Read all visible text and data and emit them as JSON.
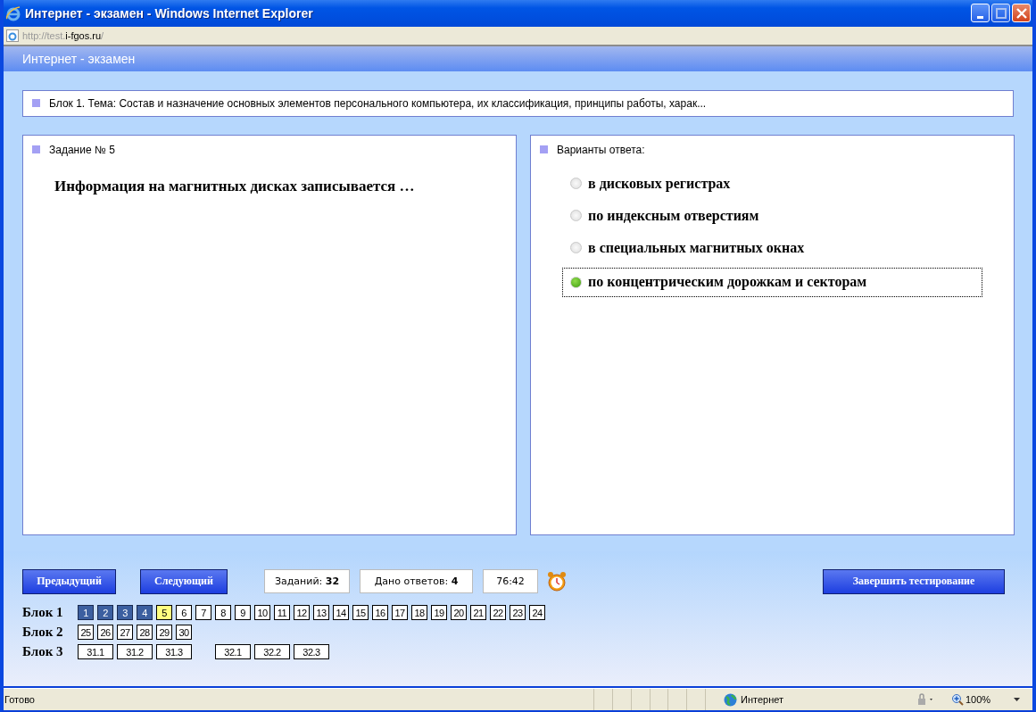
{
  "window": {
    "title": "Интернет - экзамен - Windows Internet Explorer"
  },
  "address": {
    "prefix": "http://test.",
    "domain": "i-fgos.ru",
    "suffix": "/"
  },
  "page_header": "Интернет - экзамен",
  "topic": "Блок 1. Тема: Состав и назначение основных элементов персонального компьютера, их классификация, принципы работы, харак...",
  "task": {
    "heading": "Задание № 5",
    "question": "Информация на магнитных дисках записывается …"
  },
  "answers": {
    "heading": "Варианты ответа:",
    "options": [
      {
        "label": "в дисковых регистрах",
        "selected": false
      },
      {
        "label": "по индексным отверстиям",
        "selected": false
      },
      {
        "label": "в специальных магнитных окнах",
        "selected": false
      },
      {
        "label": "по концентрическим дорожкам и секторам",
        "selected": true
      }
    ]
  },
  "nav": {
    "previous": "Предыдущий",
    "next": "Следующий",
    "finish": "Завершить тестирование"
  },
  "counters": {
    "tasks": "Заданий: **32**",
    "answered": "Дано ответов: **4**",
    "timer": "76:42"
  },
  "blocks": [
    {
      "label": "Блок 1",
      "groups": [
        [
          {
            "label": "1",
            "answered": true,
            "current": false
          },
          {
            "label": "2",
            "answered": true,
            "current": false
          },
          {
            "label": "3",
            "answered": true,
            "current": false
          },
          {
            "label": "4",
            "answered": true,
            "current": false
          },
          {
            "label": "5",
            "answered": false,
            "current": true
          },
          {
            "label": "6",
            "answered": false,
            "current": false
          },
          {
            "label": "7",
            "answered": false,
            "current": false
          },
          {
            "label": "8",
            "answered": false,
            "current": false
          },
          {
            "label": "9",
            "answered": false,
            "current": false
          },
          {
            "label": "10",
            "answered": false,
            "current": false
          },
          {
            "label": "11",
            "answered": false,
            "current": false
          },
          {
            "label": "12",
            "answered": false,
            "current": false
          },
          {
            "label": "13",
            "answered": false,
            "current": false
          },
          {
            "label": "14",
            "answered": false,
            "current": false
          },
          {
            "label": "15",
            "answered": false,
            "current": false
          },
          {
            "label": "16",
            "answered": false,
            "current": false
          },
          {
            "label": "17",
            "answered": false,
            "current": false
          },
          {
            "label": "18",
            "answered": false,
            "current": false
          },
          {
            "label": "19",
            "answered": false,
            "current": false
          },
          {
            "label": "20",
            "answered": false,
            "current": false
          },
          {
            "label": "21",
            "answered": false,
            "current": false
          },
          {
            "label": "22",
            "answered": false,
            "current": false
          },
          {
            "label": "23",
            "answered": false,
            "current": false
          },
          {
            "label": "24",
            "answered": false,
            "current": false
          }
        ]
      ]
    },
    {
      "label": "Блок 2",
      "groups": [
        [
          {
            "label": "25",
            "answered": false,
            "current": false
          },
          {
            "label": "26",
            "answered": false,
            "current": false
          },
          {
            "label": "27",
            "answered": false,
            "current": false
          },
          {
            "label": "28",
            "answered": false,
            "current": false
          },
          {
            "label": "29",
            "answered": false,
            "current": false
          },
          {
            "label": "30",
            "answered": false,
            "current": false
          }
        ]
      ]
    },
    {
      "label": "Блок 3",
      "groups": [
        [
          {
            "label": "31.1",
            "answered": false,
            "current": false
          },
          {
            "label": "31.2",
            "answered": false,
            "current": false
          },
          {
            "label": "31.3",
            "answered": false,
            "current": false
          }
        ],
        [
          {
            "label": "32.1",
            "answered": false,
            "current": false
          },
          {
            "label": "32.2",
            "answered": false,
            "current": false
          },
          {
            "label": "32.3",
            "answered": false,
            "current": false
          }
        ]
      ]
    }
  ],
  "status_bar": {
    "text": "Готово",
    "zone": "Интернет",
    "zoom": "100%"
  }
}
